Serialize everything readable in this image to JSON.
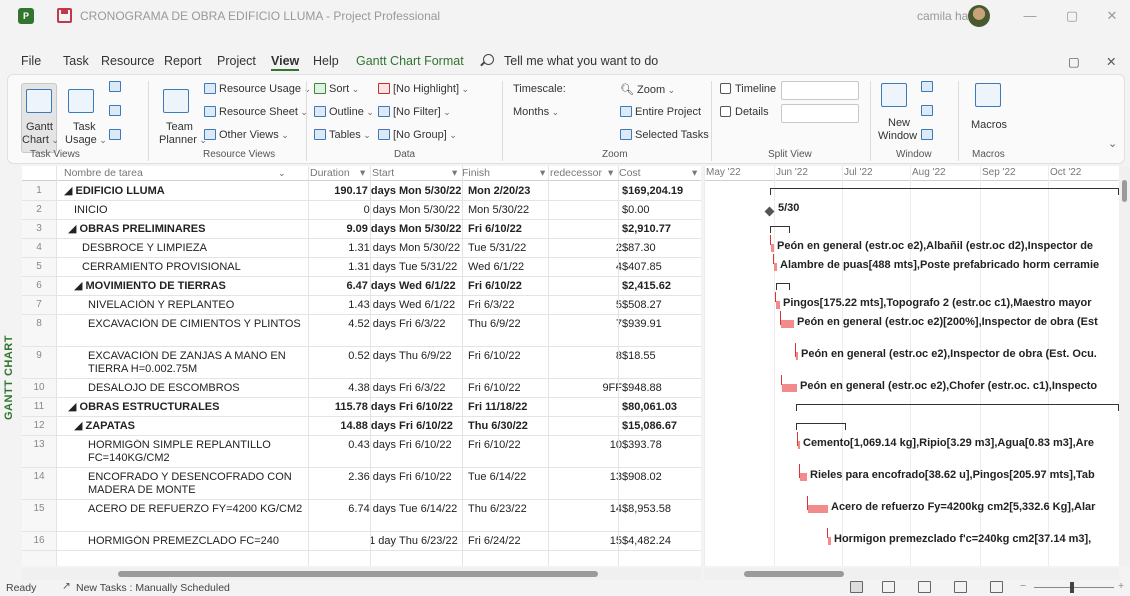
{
  "window": {
    "title": "CRONOGRAMA DE OBRA EDIFICIO LLUMA  -  Project Professional",
    "user": "camila haro",
    "minimize": "—",
    "restore": "▢",
    "close": "✕"
  },
  "menu": {
    "items": [
      "File",
      "Task",
      "Resource",
      "Report",
      "Project",
      "View",
      "Help",
      "Gantt Chart Format"
    ],
    "active": "View",
    "tell_me": "Tell me what you want to do",
    "restore_icon": "▢",
    "close_icon": "✕"
  },
  "ribbon": {
    "task_views": {
      "label": "Task Views",
      "gantt_chart": "Gantt",
      "gantt_chart_2": "Chart",
      "task_usage": "Task",
      "task_usage_2": "Usage"
    },
    "resource_views": {
      "label": "Resource Views",
      "team_planner": "Team",
      "team_planner_2": "Planner",
      "resource_usage": "Resource Usage",
      "resource_sheet": "Resource Sheet",
      "other_views": "Other Views"
    },
    "data": {
      "label": "Data",
      "sort": "Sort",
      "outline": "Outline",
      "tables": "Tables",
      "highlight": "[No Highlight]",
      "filter": "[No Filter]",
      "group": "[No Group]"
    },
    "zoom": {
      "label": "Zoom",
      "timescale": "Timescale:",
      "timescale_value": "Months",
      "zoom": "Zoom",
      "entire_project": "Entire Project",
      "selected_tasks": "Selected Tasks"
    },
    "split_view": {
      "label": "Split View",
      "timeline": "Timeline",
      "details": "Details"
    },
    "window_group": {
      "label": "Window",
      "new_window": "New",
      "new_window_2": "Window"
    },
    "macros": {
      "label": "Macros",
      "macros": "Macros"
    }
  },
  "side_label": "GANTT CHART",
  "columns": {
    "name": "Nombre de tarea",
    "duration": "Duration",
    "start": "Start",
    "finish": "Finish",
    "predecessors": "redecessor",
    "cost": "Cost"
  },
  "tasks": [
    {
      "id": "1",
      "name": "◢ EDIFICIO LLUMA",
      "duration": "190.17 days",
      "start": "Mon 5/30/22",
      "finish": "Mon 2/20/23",
      "pred": "",
      "cost": "$169,204.19",
      "summary": true
    },
    {
      "id": "2",
      "name": "INICIO",
      "duration": "0 days",
      "start": "Mon 5/30/22",
      "finish": "Mon 5/30/22",
      "pred": "",
      "cost": "$0.00",
      "summary": false
    },
    {
      "id": "3",
      "name": "◢ OBRAS PRELIMINARES",
      "duration": "9.09 days",
      "start": "Mon 5/30/22",
      "finish": "Fri 6/10/22",
      "pred": "",
      "cost": "$2,910.77",
      "summary": true
    },
    {
      "id": "4",
      "name": "DESBROCE Y LIMPIEZA",
      "duration": "1.31 days",
      "start": "Mon 5/30/22",
      "finish": "Tue 5/31/22",
      "pred": "2",
      "cost": "$87.30",
      "summary": false
    },
    {
      "id": "5",
      "name": "CERRAMIENTO PROVISIONAL",
      "duration": "1.31 days",
      "start": "Tue 5/31/22",
      "finish": "Wed 6/1/22",
      "pred": "4",
      "cost": "$407.85",
      "summary": false
    },
    {
      "id": "6",
      "name": "◢ MOVIMIENTO DE TIERRAS",
      "duration": "6.47 days",
      "start": "Wed 6/1/22",
      "finish": "Fri 6/10/22",
      "pred": "",
      "cost": "$2,415.62",
      "summary": true
    },
    {
      "id": "7",
      "name": "NIVELACIÓN Y REPLANTEO",
      "duration": "1.43 days",
      "start": "Wed 6/1/22",
      "finish": "Fri 6/3/22",
      "pred": "5",
      "cost": "$508.27",
      "summary": false
    },
    {
      "id": "8",
      "name": "EXCAVACIÓN DE CIMIENTOS Y PLINTOS",
      "duration": "4.52 days",
      "start": "Fri 6/3/22",
      "finish": "Thu 6/9/22",
      "pred": "7",
      "cost": "$939.91",
      "summary": false
    },
    {
      "id": "9",
      "name": "EXCAVACIÓN DE ZANJAS A MANO EN TIERRA H=0.002.75M",
      "duration": "0.52 days",
      "start": "Thu 6/9/22",
      "finish": "Fri 6/10/22",
      "pred": "8",
      "cost": "$18.55",
      "summary": false
    },
    {
      "id": "10",
      "name": "DESALOJO DE ESCOMBROS",
      "duration": "4.38 days",
      "start": "Fri 6/3/22",
      "finish": "Fri 6/10/22",
      "pred": "9FF",
      "cost": "$948.88",
      "summary": false
    },
    {
      "id": "11",
      "name": "◢ OBRAS ESTRUCTURALES",
      "duration": "115.78 days",
      "start": "Fri 6/10/22",
      "finish": "Fri 11/18/22",
      "pred": "",
      "cost": "$80,061.03",
      "summary": true
    },
    {
      "id": "12",
      "name": "◢ ZAPATAS",
      "duration": "14.88 days",
      "start": "Fri 6/10/22",
      "finish": "Thu 6/30/22",
      "pred": "",
      "cost": "$15,086.67",
      "summary": true
    },
    {
      "id": "13",
      "name": "HORMIGÓN SIMPLE REPLANTILLO FC=140KG/CM2",
      "duration": "0.43 days",
      "start": "Fri 6/10/22",
      "finish": "Fri 6/10/22",
      "pred": "10",
      "cost": "$393.78",
      "summary": false
    },
    {
      "id": "14",
      "name": "ENCOFRADO Y DESENCOFRADO CON MADERA DE MONTE",
      "duration": "2.36 days",
      "start": "Fri 6/10/22",
      "finish": "Tue 6/14/22",
      "pred": "13",
      "cost": "$908.02",
      "summary": false
    },
    {
      "id": "15",
      "name": "ACERO DE REFUERZO FY=4200 KG/CM2",
      "duration": "6.74 days",
      "start": "Tue 6/14/22",
      "finish": "Thu 6/23/22",
      "pred": "14",
      "cost": "$8,953.58",
      "summary": false
    },
    {
      "id": "16",
      "name": "HORMIGÓN PREMEZCLADO FC=240",
      "duration": "1 day",
      "start": "Thu 6/23/22",
      "finish": "Fri 6/24/22",
      "pred": "15",
      "cost": "$4,482.24",
      "summary": false
    }
  ],
  "gantt": {
    "months": [
      "May '22",
      "Jun '22",
      "Jul '22",
      "Aug '22",
      "Sep '22",
      "Oct '22"
    ],
    "milestone_label": "5/30",
    "resources": {
      "4": "Peón en general (estr.oc e2),Albañil (estr.oc d2),Inspector de",
      "5": "Alambre de puas[488 mts],Poste prefabricado horm cerramie",
      "7": "Pingos[175.22 mts],Topografo 2 (estr.oc c1),Maestro mayor",
      "8": "Peón en general (estr.oc e2)[200%],Inspector de obra (Est",
      "9": "Peón en general (estr.oc e2),Inspector de obra (Est. Ocu.",
      "10": "Peón en general (estr.oc e2),Chofer (estr.oc. c1),Inspecto",
      "13": "Cemento[1,069.14 kg],Ripio[3.29 m3],Agua[0.83 m3],Are",
      "14": "Rieles para encofrado[38.62 u],Pingos[205.97 mts],Tab",
      "15": "Acero de refuerzo Fy=4200kg cm2[5,332.6 Kg],Alar",
      "16": "Hormigon premezclado f'c=240kg cm2[37.14 m3],"
    }
  },
  "status": {
    "ready": "Ready",
    "new_tasks": "New Tasks : Manually Scheduled"
  }
}
